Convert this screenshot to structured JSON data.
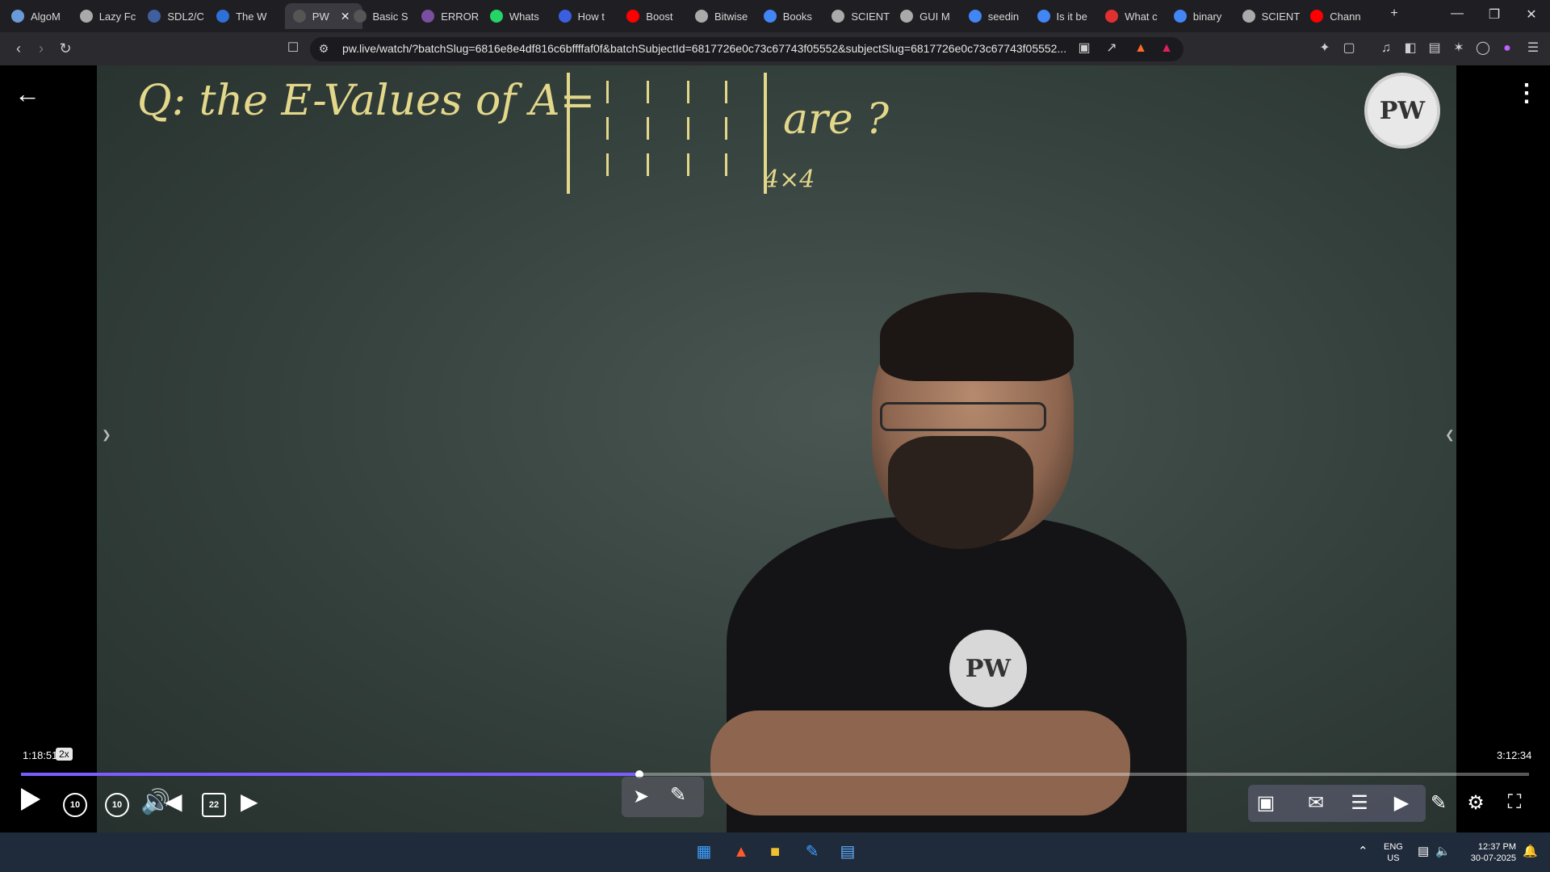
{
  "browser": {
    "tabs": [
      {
        "label": "AlgoM",
        "color": "#6a9bd8"
      },
      {
        "label": "Lazy Fc",
        "color": "#aaaaaa"
      },
      {
        "label": "SDL2/C",
        "color": "#3f5f9f"
      },
      {
        "label": "The W",
        "color": "#2f6fd8"
      },
      {
        "label": "PW",
        "color": "#555555",
        "active": true
      },
      {
        "label": "Basic S",
        "color": "#555555"
      },
      {
        "label": "ERROR",
        "color": "#7a4f9f"
      },
      {
        "label": "Whats",
        "color": "#25d366"
      },
      {
        "label": "How t",
        "color": "#3a5fe0"
      },
      {
        "label": "Boost",
        "color": "#ff0000"
      },
      {
        "label": "Bitwise",
        "color": "#aaaaaa"
      },
      {
        "label": "Books",
        "color": "#4285f4"
      },
      {
        "label": "SCIENT",
        "color": "#aaaaaa"
      },
      {
        "label": "GUI M",
        "color": "#aaaaaa"
      },
      {
        "label": "seedin",
        "color": "#4285f4"
      },
      {
        "label": "Is it be",
        "color": "#4285f4"
      },
      {
        "label": "What c",
        "color": "#e03030"
      },
      {
        "label": "binary",
        "color": "#4285f4"
      },
      {
        "label": "SCIENT",
        "color": "#aaaaaa"
      },
      {
        "label": "Chann",
        "color": "#ff0000"
      }
    ],
    "new_tab": "+",
    "url": "pw.live/watch/?batchSlug=6816e8e4df816c6bffffaf0f&batchSubjectId=6817726e0c73c67743f05552&subjectSlug=6817726e0c73c67743f05552..."
  },
  "board": {
    "question": "Q:  the E-Values of A=",
    "tail": "are ?",
    "dim": "4×4"
  },
  "logo": "PW",
  "player": {
    "current_time": "1:18:51",
    "speed": "2x",
    "total_time": "3:12:34",
    "progress": 0.41,
    "rewind_label": "10",
    "forward_label": "10",
    "notes_count": "22"
  },
  "taskbar": {
    "lang_top": "ENG",
    "lang_bottom": "US",
    "time": "12:37 PM",
    "date": "30-07-2025"
  }
}
